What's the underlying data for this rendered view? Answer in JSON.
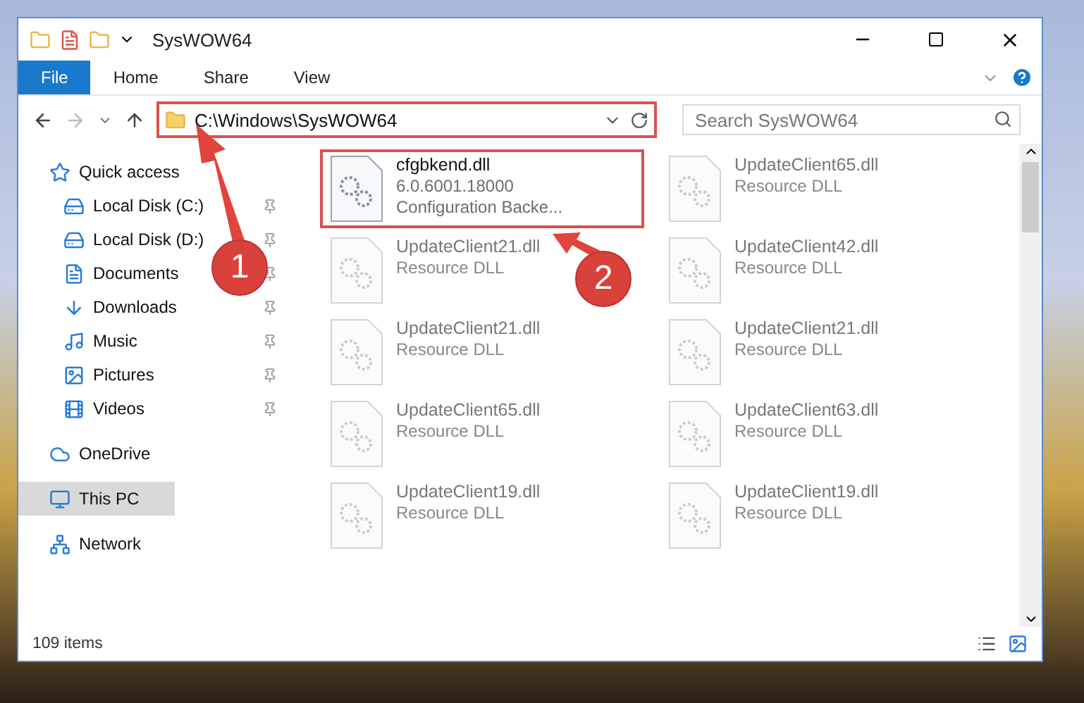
{
  "window": {
    "title": "SysWOW64"
  },
  "ribbon_tabs": [
    {
      "label": "File",
      "selected": true
    },
    {
      "label": "Home",
      "selected": false
    },
    {
      "label": "Share",
      "selected": false
    },
    {
      "label": "View",
      "selected": false
    }
  ],
  "address_bar": {
    "path": "C:\\Windows\\SysWOW64",
    "highlighted": true
  },
  "search": {
    "placeholder": "Search SysWOW64"
  },
  "sidebar": {
    "items": [
      {
        "label": "Quick access",
        "selected": false,
        "children": [
          {
            "label": "Local Disk (C:)",
            "pinned": true,
            "selected": false
          },
          {
            "label": "Local Disk (D:)",
            "pinned": true,
            "selected": false
          },
          {
            "label": "Documents",
            "pinned": true,
            "selected": false
          },
          {
            "label": "Downloads",
            "pinned": true,
            "selected": false
          },
          {
            "label": "Music",
            "pinned": true,
            "selected": false
          },
          {
            "label": "Pictures",
            "pinned": true,
            "selected": false
          },
          {
            "label": "Videos",
            "pinned": true,
            "selected": false
          }
        ]
      },
      {
        "label": "OneDrive",
        "selected": false
      },
      {
        "label": "This PC",
        "selected": true
      },
      {
        "label": "Network",
        "selected": false
      }
    ]
  },
  "files": [
    {
      "name": "cfgbkend.dll",
      "details": [
        "6.0.6001.18000",
        "Configuration Backe..."
      ],
      "highlighted": true,
      "faded": false
    },
    {
      "name": "UpdateClient65.dll",
      "details": [
        "Resource DLL"
      ],
      "highlighted": false,
      "faded": true
    },
    {
      "name": "UpdateClient21.dll",
      "details": [
        "Resource DLL"
      ],
      "highlighted": false,
      "faded": true
    },
    {
      "name": "UpdateClient42.dll",
      "details": [
        "Resource DLL"
      ],
      "highlighted": false,
      "faded": true
    },
    {
      "name": "UpdateClient21.dll",
      "details": [
        "Resource DLL"
      ],
      "highlighted": false,
      "faded": true
    },
    {
      "name": "UpdateClient21.dll",
      "details": [
        "Resource DLL"
      ],
      "highlighted": false,
      "faded": true
    },
    {
      "name": "UpdateClient65.dll",
      "details": [
        "Resource DLL"
      ],
      "highlighted": false,
      "faded": true
    },
    {
      "name": "UpdateClient63.dll",
      "details": [
        "Resource DLL"
      ],
      "highlighted": false,
      "faded": true
    },
    {
      "name": "UpdateClient19.dll",
      "details": [
        "Resource DLL"
      ],
      "highlighted": false,
      "faded": true
    },
    {
      "name": "UpdateClient19.dll",
      "details": [
        "Resource DLL"
      ],
      "highlighted": false,
      "faded": true
    }
  ],
  "status_bar": {
    "item_count": "109 items"
  },
  "annotations": [
    {
      "number": "1"
    },
    {
      "number": "2"
    }
  ]
}
